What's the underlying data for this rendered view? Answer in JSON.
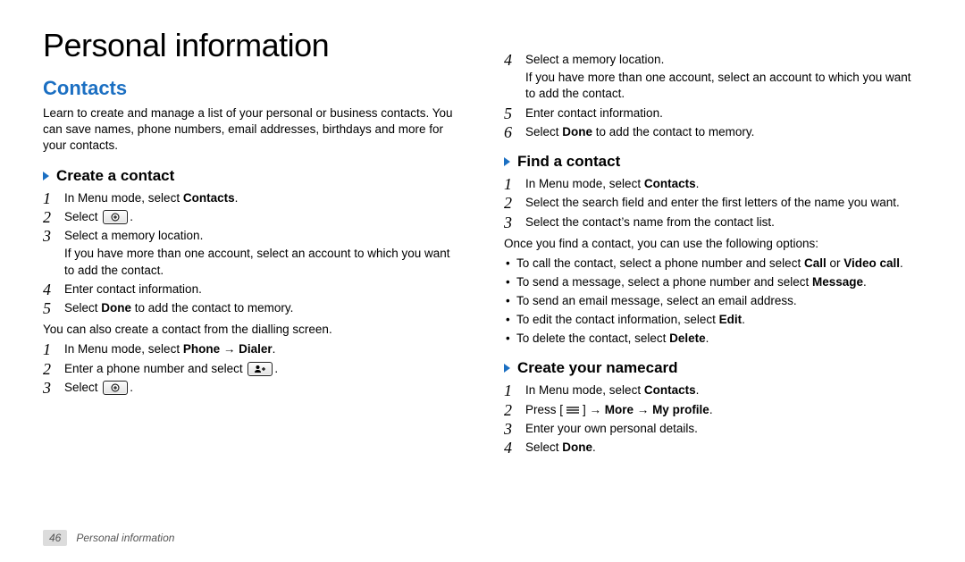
{
  "title": "Personal information",
  "section": "Contacts",
  "intro": "Learn to create and manage a list of your personal or business contacts. You can save names, phone numbers, email addresses, birthdays and more for your contacts.",
  "create": {
    "heading": "Create a contact",
    "s1_a": "In Menu mode, select ",
    "s1_b": "Contacts",
    "s1_c": ".",
    "s2_a": "Select ",
    "s2_c": ".",
    "s3_a": "Select a memory location.",
    "s3_b": "If you have more than one account, select an account to which you want to add the contact.",
    "s4": "Enter contact information.",
    "s5_a": "Select ",
    "s5_b": "Done",
    "s5_c": " to add the contact to memory."
  },
  "alt_intro": "You can also create a contact from the dialling screen.",
  "alt": {
    "s1_a": "In Menu mode, select ",
    "s1_b": "Phone",
    "s1_c": " → ",
    "s1_d": "Dialer",
    "s1_e": ".",
    "s2_a": "Enter a phone number and select ",
    "s2_c": ".",
    "s3_a": "Select ",
    "s3_c": "."
  },
  "cont": {
    "s4_a": "Select a memory location.",
    "s4_b": "If you have more than one account, select an account to which you want to add the contact.",
    "s5": "Enter contact information.",
    "s6_a": "Select ",
    "s6_b": "Done",
    "s6_c": " to add the contact to memory."
  },
  "find": {
    "heading": "Find a contact",
    "s1_a": "In Menu mode, select ",
    "s1_b": "Contacts",
    "s1_c": ".",
    "s2": "Select the search field and enter the first letters of the name you want.",
    "s3": "Select the contact’s name from the contact list."
  },
  "options_intro": "Once you find a contact, you can use the following options:",
  "options": {
    "b1_a": "To call the contact, select a phone number and select ",
    "b1_b": "Call",
    "b1_c": " or ",
    "b1_d": "Video call",
    "b1_e": ".",
    "b2_a": "To send a message, select a phone number and select ",
    "b2_b": "Message",
    "b2_c": ".",
    "b3": "To send an email message, select an email address.",
    "b4_a": "To edit the contact information, select ",
    "b4_b": "Edit",
    "b4_c": ".",
    "b5_a": "To delete the contact, select ",
    "b5_b": "Delete",
    "b5_c": "."
  },
  "namecard": {
    "heading": "Create your namecard",
    "s1_a": "In Menu mode, select ",
    "s1_b": "Contacts",
    "s1_c": ".",
    "s2_a": "Press [",
    "s2_b": "] → ",
    "s2_c": "More",
    "s2_d": " → ",
    "s2_e": "My profile",
    "s2_f": ".",
    "s3": "Enter your own personal details.",
    "s4_a": "Select ",
    "s4_b": "Done",
    "s4_c": "."
  },
  "nums": {
    "n1": "1",
    "n2": "2",
    "n3": "3",
    "n4": "4",
    "n5": "5",
    "n6": "6"
  },
  "footer": {
    "page": "46",
    "label": "Personal information"
  }
}
